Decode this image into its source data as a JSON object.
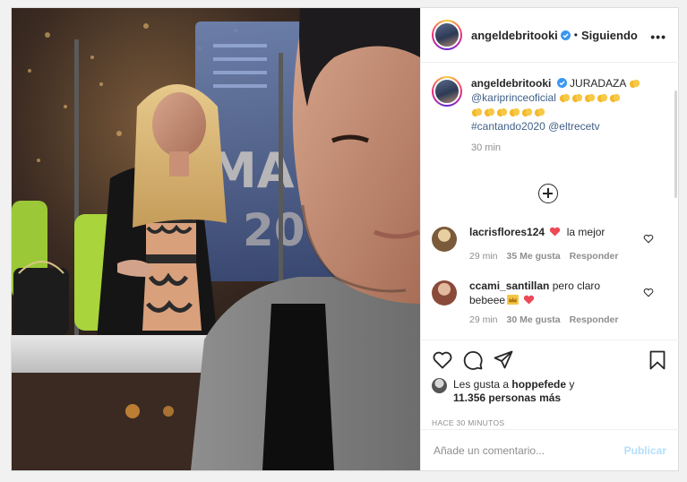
{
  "post_header": {
    "username": "angeldebritooki",
    "separator": "•",
    "follow_status": "Siguiendo",
    "more": "•••"
  },
  "caption": {
    "username": "angeldebritooki",
    "text": "JURADAZA",
    "mention": "@kariprinceoficial",
    "hashtag": "#cantando2020",
    "mention2": "@eltrecetv",
    "time": "30 min"
  },
  "comments": [
    {
      "username": "lacrisflores124",
      "text": "la mejor",
      "time": "29 min",
      "likes": "35 Me gusta",
      "reply": "Responder"
    },
    {
      "username": "ccami_santillan",
      "text_before": "pero claro",
      "text_after": "bebeee",
      "time": "29 min",
      "likes": "30 Me gusta",
      "reply": "Responder"
    }
  ],
  "likes_info": {
    "prefix": "Les gusta a",
    "user": "hoppefede",
    "joiner": "y",
    "count": "11.356 personas más"
  },
  "posted_ago": "HACE 30 MINUTOS",
  "add_comment": {
    "placeholder": "Añade un comentario...",
    "publish": "Publicar"
  },
  "colors": {
    "link": "#3f5f87",
    "verified": "#3897f0",
    "publish_disabled": "#b2dffc",
    "heart_red": "#ed4956",
    "clap": "#f5b82a"
  },
  "icons": [
    "verified-badge-icon",
    "more-options-icon",
    "clap-emoji-icon",
    "load-more-comments-icon",
    "heart-icon",
    "red-heart-emoji-icon",
    "crown-emoji-icon",
    "comment-icon",
    "share-icon",
    "bookmark-icon"
  ]
}
